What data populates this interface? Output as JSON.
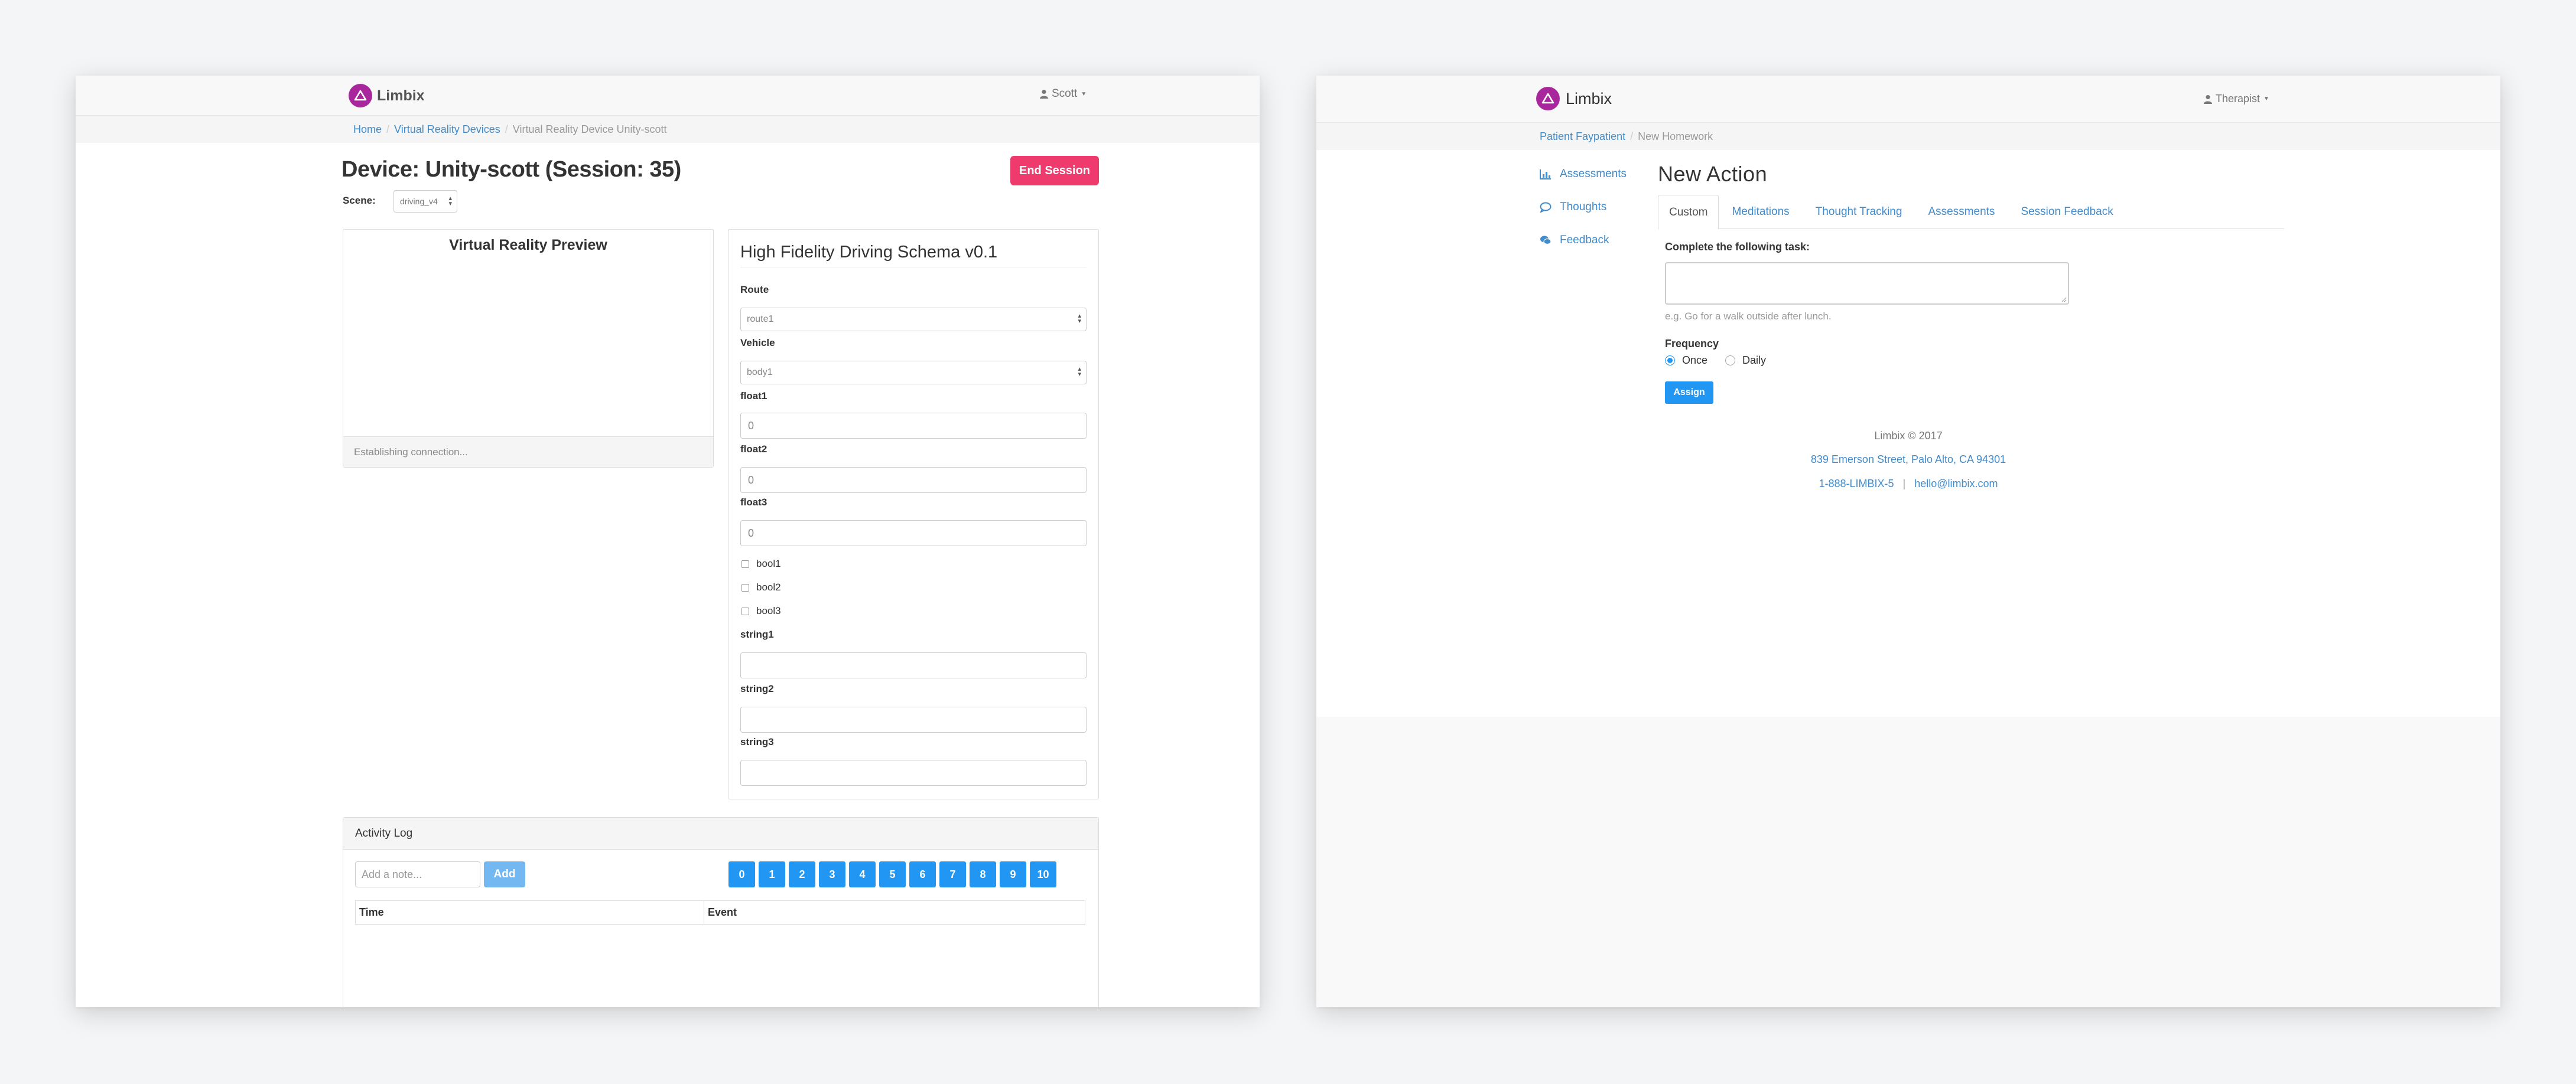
{
  "left": {
    "brand": "Limbix",
    "user": "Scott",
    "breadcrumb": [
      "Home",
      "Virtual Reality Devices",
      "Virtual Reality Device Unity-scott"
    ],
    "title": "Device: Unity-scott (Session: 35)",
    "end_session_label": "End Session",
    "scene_label": "Scene:",
    "scene_value": "driving_v4",
    "vr_preview_title": "Virtual Reality Preview",
    "vr_status": "Establishing connection...",
    "schema_title": "High Fidelity Driving Schema v0.1",
    "fields": {
      "route_label": "Route",
      "route_value": "route1",
      "vehicle_label": "Vehicle",
      "vehicle_value": "body1",
      "float1_label": "float1",
      "float1_value": "0",
      "float2_label": "float2",
      "float2_value": "0",
      "float3_label": "float3",
      "float3_value": "0",
      "bool1": "bool1",
      "bool2": "bool2",
      "bool3": "bool3",
      "string1_label": "string1",
      "string2_label": "string2",
      "string3_label": "string3"
    },
    "activity_log": {
      "title": "Activity Log",
      "note_placeholder": "Add a note...",
      "add_label": "Add",
      "number_buttons": [
        "0",
        "1",
        "2",
        "3",
        "4",
        "5",
        "6",
        "7",
        "8",
        "9",
        "10"
      ],
      "columns": [
        "Time",
        "Event"
      ]
    }
  },
  "right": {
    "brand": "Limbix",
    "user": "Therapist",
    "breadcrumb": [
      "Patient Faypatient",
      "New Homework"
    ],
    "sidebar": [
      {
        "label": "Assessments",
        "icon": "bar-chart-icon"
      },
      {
        "label": "Thoughts",
        "icon": "comment-icon"
      },
      {
        "label": "Feedback",
        "icon": "comments-icon"
      }
    ],
    "title": "New Action",
    "tabs": [
      "Custom",
      "Meditations",
      "Thought Tracking",
      "Assessments",
      "Session Feedback"
    ],
    "active_tab": "Custom",
    "task_label": "Complete the following task:",
    "task_help": "e.g. Go for a walk outside after lunch.",
    "frequency_label": "Frequency",
    "frequency_options": [
      "Once",
      "Daily"
    ],
    "frequency_selected": "Once",
    "assign_label": "Assign",
    "footer": {
      "copyright": "Limbix © 2017",
      "address": "839 Emerson Street, Palo Alto, CA 94301",
      "phone": "1-888-LIMBIX-5",
      "separator": "|",
      "email": "hello@limbix.com"
    },
    "colors": {
      "accent": "#2196f3",
      "brand": "#a8279c",
      "danger": "#ee3a6c"
    }
  }
}
